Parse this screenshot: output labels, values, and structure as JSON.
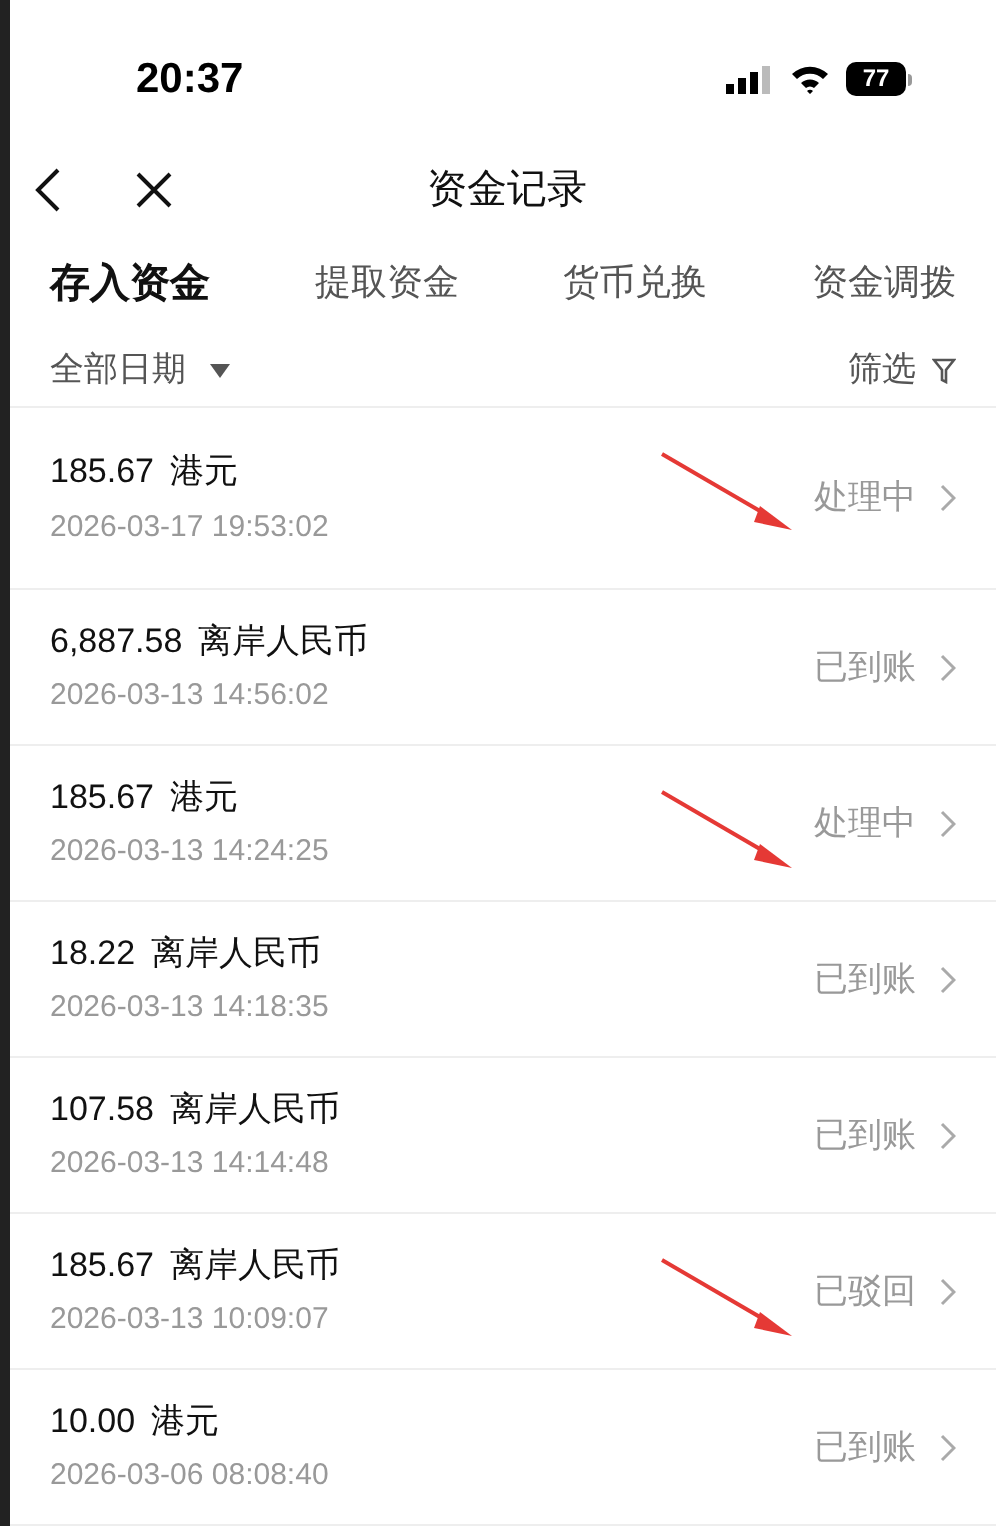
{
  "status_bar": {
    "time": "20:37",
    "battery": "77"
  },
  "header": {
    "title": "资金记录"
  },
  "tabs": [
    {
      "label": "存入资金",
      "selected": true
    },
    {
      "label": "提取资金",
      "selected": false
    },
    {
      "label": "货币兑换",
      "selected": false
    },
    {
      "label": "资金调拨",
      "selected": false
    }
  ],
  "filters": {
    "date": "全部日期",
    "filter": "筛选"
  },
  "records": [
    {
      "amount": "185.67",
      "currency": "港元",
      "time": "2026-03-17 19:53:02",
      "status": "处理中",
      "arrow": true
    },
    {
      "amount": "6,887.58",
      "currency": "离岸人民币",
      "time": "2026-03-13 14:56:02",
      "status": "已到账",
      "arrow": false
    },
    {
      "amount": "185.67",
      "currency": "港元",
      "time": "2026-03-13 14:24:25",
      "status": "处理中",
      "arrow": true
    },
    {
      "amount": "18.22",
      "currency": "离岸人民币",
      "time": "2026-03-13 14:18:35",
      "status": "已到账",
      "arrow": false
    },
    {
      "amount": "107.58",
      "currency": "离岸人民币",
      "time": "2026-03-13 14:14:48",
      "status": "已到账",
      "arrow": false
    },
    {
      "amount": "185.67",
      "currency": "离岸人民币",
      "time": "2026-03-13 10:09:07",
      "status": "已驳回",
      "arrow": true
    },
    {
      "amount": "10.00",
      "currency": "港元",
      "time": "2026-03-06 08:08:40",
      "status": "已到账",
      "arrow": false
    }
  ]
}
